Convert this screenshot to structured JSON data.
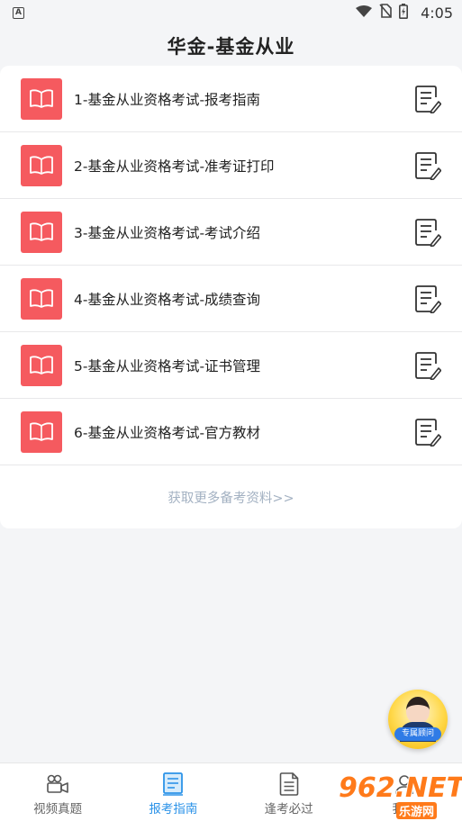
{
  "status_bar": {
    "left_badge": "A",
    "time": "4:05"
  },
  "header": {
    "title": "华金-基金从业"
  },
  "list": {
    "items": [
      {
        "label": "1-基金从业资格考试-报考指南"
      },
      {
        "label": "2-基金从业资格考试-准考证打印"
      },
      {
        "label": "3-基金从业资格考试-考试介绍"
      },
      {
        "label": "4-基金从业资格考试-成绩查询"
      },
      {
        "label": "5-基金从业资格考试-证书管理"
      },
      {
        "label": "6-基金从业资格考试-官方教材"
      }
    ],
    "more_link": "获取更多备考资料>>"
  },
  "advisor": {
    "label": "专属顾问"
  },
  "tabs": [
    {
      "label": "视频真题",
      "icon": "video-camera-icon",
      "active": false
    },
    {
      "label": "报考指南",
      "icon": "book-icon",
      "active": true
    },
    {
      "label": "逢考必过",
      "icon": "document-icon",
      "active": false
    },
    {
      "label": "我的",
      "icon": "user-icon",
      "active": false
    }
  ],
  "watermark": {
    "big": "962.NET",
    "small": "乐游网"
  },
  "colors": {
    "accent": "#2c93e8",
    "book_red": "#f55a5f",
    "more_link": "#a3b1c2",
    "background": "#f4f5f7"
  }
}
